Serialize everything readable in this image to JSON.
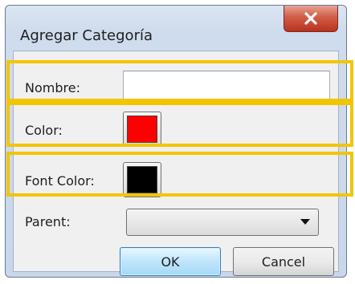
{
  "dialog": {
    "title": "Agregar Categoría",
    "close_glyph": "X"
  },
  "form": {
    "nombre": {
      "label": "Nombre:",
      "value": ""
    },
    "color": {
      "label": "Color:",
      "value": "#ff0000"
    },
    "font_color": {
      "label": "Font Color:",
      "value": "#000000"
    },
    "parent": {
      "label": "Parent:",
      "value": ""
    }
  },
  "buttons": {
    "ok": "OK",
    "cancel": "Cancel"
  },
  "colors": {
    "highlight": "#f2c500",
    "ok_border": "#3c7fb1",
    "close_red": "#c84530"
  }
}
